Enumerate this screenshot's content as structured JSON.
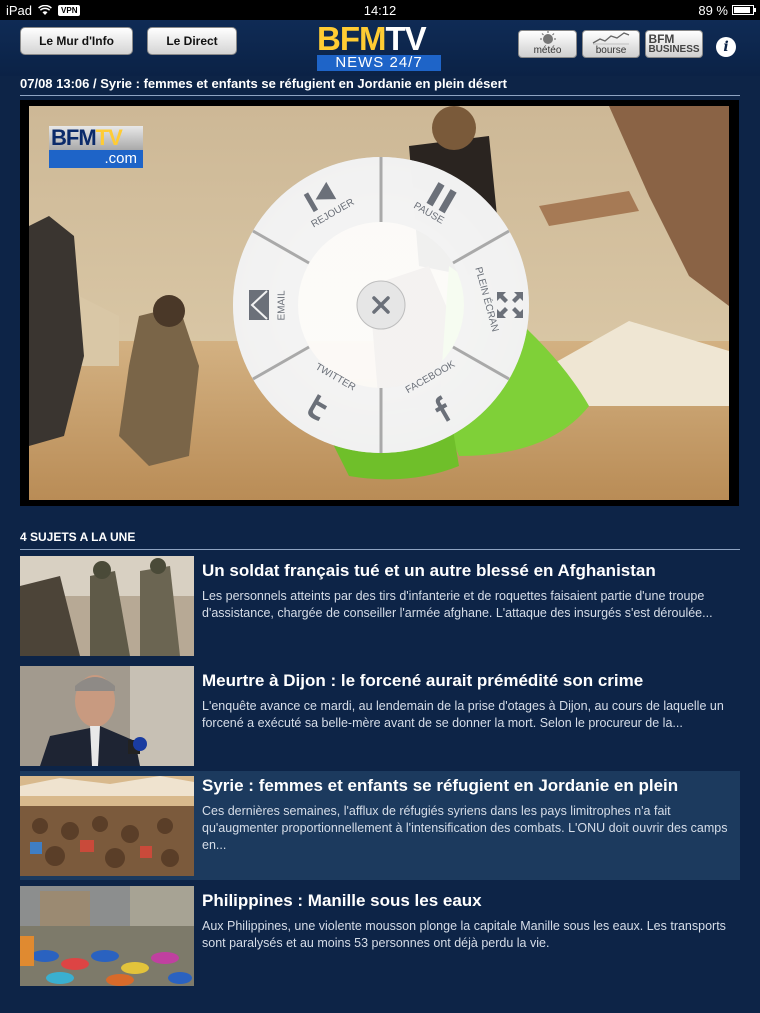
{
  "status_bar": {
    "device": "iPad",
    "vpn": "VPN",
    "time": "14:12",
    "battery": "89 %"
  },
  "header": {
    "mur_label": "Le Mur d'Info",
    "direct_label": "Le Direct",
    "logo_bfm_1": "BFM",
    "logo_bfm_2": "TV",
    "logo_news": "NEWS 24/7",
    "meteo_label": "météo",
    "bourse_label": "bourse",
    "bfm_business_line1": "BFM",
    "bfm_business_line2": "BUSINESS",
    "info_label": "i"
  },
  "headline": "07/08 13:06 / Syrie : femmes et enfants se réfugient en Jordanie en plein désert",
  "video": {
    "logo_bfm_1": "BFM",
    "logo_bfm_2": "TV",
    "logo_com": ".com",
    "menu": {
      "rejouer": "REJOUER",
      "pause": "PAUSE",
      "plein_ecran": "PLEIN ÉCRAN",
      "facebook": "FACEBOOK",
      "twitter": "TWITTER",
      "email": "EMAIL"
    }
  },
  "section_title": "4 SUJETS A LA UNE",
  "stories": [
    {
      "title": "Un soldat français tué et un autre blessé en Afghanistan",
      "desc": "Les personnels atteints par des tirs d'infanterie et de roquettes faisaient partie d'une troupe d'assistance, chargée de conseiller l'armée afghane. L'attaque des insurgés s'est déroulée..."
    },
    {
      "title": "Meurtre à Dijon : le forcené aurait prémédité son crime",
      "desc": "L'enquête avance ce mardi, au  lendemain de la prise d'otages à Dijon, au cours de laquelle un forcené a exécuté sa belle-mère avant de se donner la mort. Selon le procureur de la..."
    },
    {
      "title": "Syrie : femmes et enfants se réfugient en Jordanie en plein",
      "desc": "Ces dernières semaines, l'afflux de réfugiés syriens dans les pays limitrophes n'a fait qu'augmenter proportionnellement à l'intensification des combats. L'ONU doit ouvrir des camps en..."
    },
    {
      "title": "Philippines : Manille sous les eaux",
      "desc": "Aux Philippines,  une violente mousson plonge la capitale Manille sous les eaux.  Les transports sont paralysés et au moins 53 personnes ont déjà perdu la vie."
    }
  ]
}
